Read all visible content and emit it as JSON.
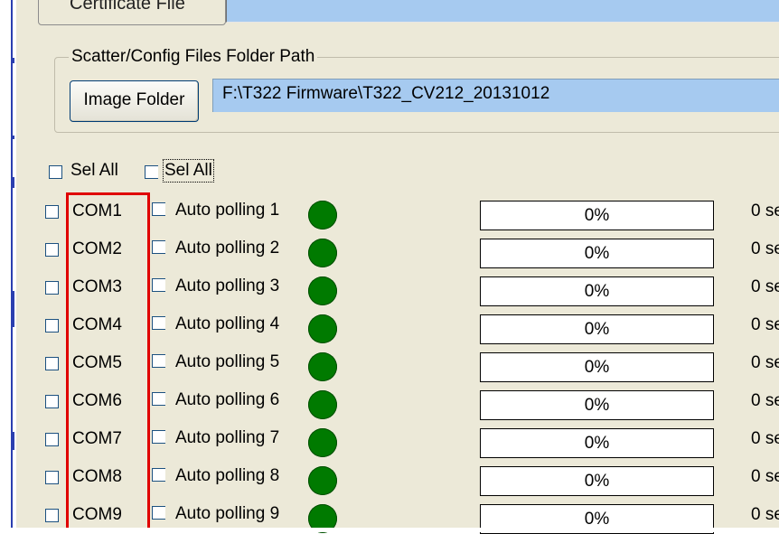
{
  "certificate": {
    "tab_label": "Certificate File"
  },
  "scatter_group": {
    "title": "Scatter/Config Files Folder Path",
    "button_label": "Image Folder",
    "path_value": "F:\\T322 Firmware\\T322_CV212_20131012"
  },
  "select_all": {
    "com_label": "Sel All",
    "polling_label": "Sel All"
  },
  "ports": [
    {
      "com": "COM1",
      "polling": "Auto polling 1",
      "progress": "0%",
      "progress_value": 0,
      "time": "0 se"
    },
    {
      "com": "COM2",
      "polling": "Auto polling 2",
      "progress": "0%",
      "progress_value": 0,
      "time": "0 se"
    },
    {
      "com": "COM3",
      "polling": "Auto polling 3",
      "progress": "0%",
      "progress_value": 0,
      "time": "0 se"
    },
    {
      "com": "COM4",
      "polling": "Auto polling 4",
      "progress": "0%",
      "progress_value": 0,
      "time": "0 se"
    },
    {
      "com": "COM5",
      "polling": "Auto polling 5",
      "progress": "0%",
      "progress_value": 0,
      "time": "0 se"
    },
    {
      "com": "COM6",
      "polling": "Auto polling 6",
      "progress": "0%",
      "progress_value": 0,
      "time": "0 se"
    },
    {
      "com": "COM7",
      "polling": "Auto polling 7",
      "progress": "0%",
      "progress_value": 0,
      "time": "0 se"
    },
    {
      "com": "COM8",
      "polling": "Auto polling 8",
      "progress": "0%",
      "progress_value": 0,
      "time": "0 se"
    },
    {
      "com": "COM9",
      "polling": "Auto polling 9",
      "progress": "0%",
      "progress_value": 0,
      "time": "0 se"
    }
  ],
  "colors": {
    "status_led": "#007a00",
    "path_field_bg": "#a6caf0",
    "annotation_box": "#e00000",
    "window_bg": "#ece9d8"
  },
  "icons": {
    "status_indicator": "status-led-icon"
  }
}
